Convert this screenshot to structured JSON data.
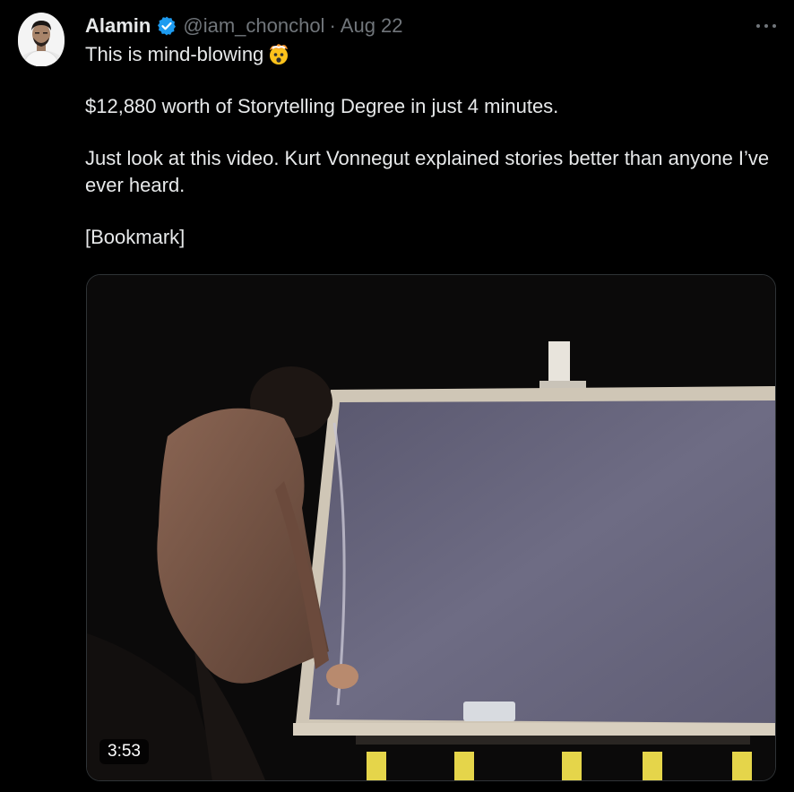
{
  "tweet": {
    "author_name": "Alamin",
    "handle": "@iam_chonchol",
    "separator": "·",
    "date": "Aug 22",
    "line1": "This is mind-blowing",
    "line2": "$12,880 worth of Storytelling Degree in just 4 minutes.",
    "line3": "Just look at this video. Kurt Vonnegut explained stories better than anyone I’ve ever heard.",
    "line4": "[Bookmark]",
    "emoji_icon": "exploding-head-icon"
  },
  "video": {
    "duration": "3:53"
  },
  "colors": {
    "background": "#000000",
    "primary_text": "#e7e9ea",
    "secondary_text": "#71767b",
    "verified_blue": "#1d9bf0"
  }
}
